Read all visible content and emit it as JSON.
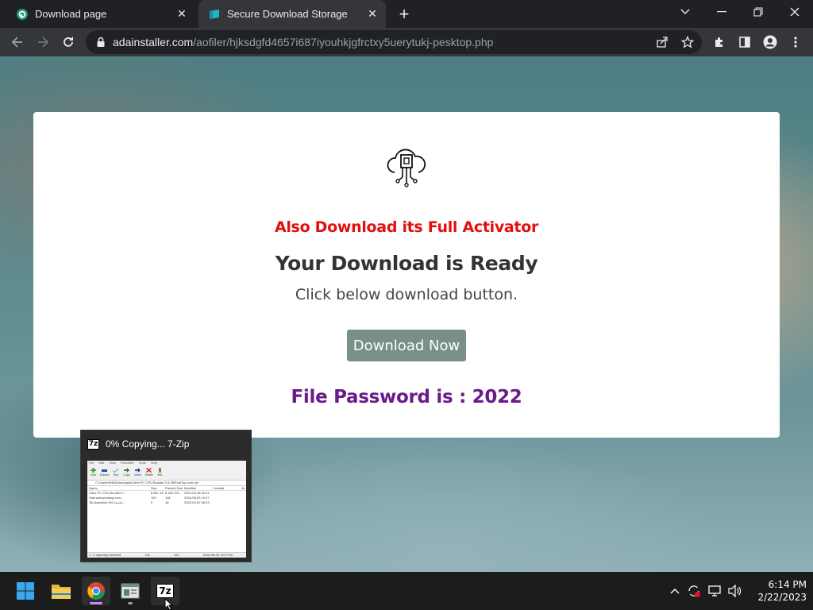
{
  "browser": {
    "tabs": [
      {
        "title": "Download page",
        "active": false
      },
      {
        "title": "Secure Download Storage",
        "active": true
      }
    ],
    "url_domain": "adainstaller.com",
    "url_path": "/aofiler/hjksdgfd4657i687iyouhkjgfrctxy5uerytukj-pesktop.php"
  },
  "page": {
    "promo": "Also Download its Full Activator",
    "headline": "Your Download is Ready",
    "subline": "Click below download button.",
    "download_button": "Download Now",
    "password_line": "File Password is : 2022",
    "colors": {
      "promo": "#e30f0f",
      "password": "#6a1a8a",
      "button": "#7a8f87"
    }
  },
  "taskbar_preview": {
    "title": "0% Copying... 7-Zip",
    "badge": "7z",
    "thumb": {
      "menu": [
        "File",
        "Edit",
        "View",
        "Favorites",
        "Tools",
        "Help"
      ],
      "tools": [
        "Add",
        "Extract",
        "Test",
        "Copy",
        "Move",
        "Delete",
        "Info"
      ],
      "address": "C:\\Users\\WIN\\Downloads\\Citrix PC CPU Booster 2.8.48\\PostTop.com.rar\\",
      "columns": [
        "Name",
        "Size",
        "Packed Size",
        "Modified",
        "Created",
        "Ac"
      ],
      "rows": [
        [
          "Citrix PC CPU Booster 2...",
          "8 857 344",
          "8 484 224",
          "2022-06-08 02:41",
          "",
          ""
        ],
        [
          "Visit www.posttop.com...",
          "120",
          "118",
          "2016-06-03 19:27",
          "",
          ""
        ],
        [
          "Tip-Assistant 102 (جديد)...",
          "0",
          "18",
          "2020-04-02 06:23",
          "",
          ""
        ]
      ],
      "status": [
        "1 / 3 object(s) selected",
        "122",
        "122",
        "2016-06-03 19:27:00"
      ]
    }
  },
  "taskbar": {
    "time": "6:14 PM",
    "date": "2/22/2023",
    "sevenzip_label": "7z"
  }
}
